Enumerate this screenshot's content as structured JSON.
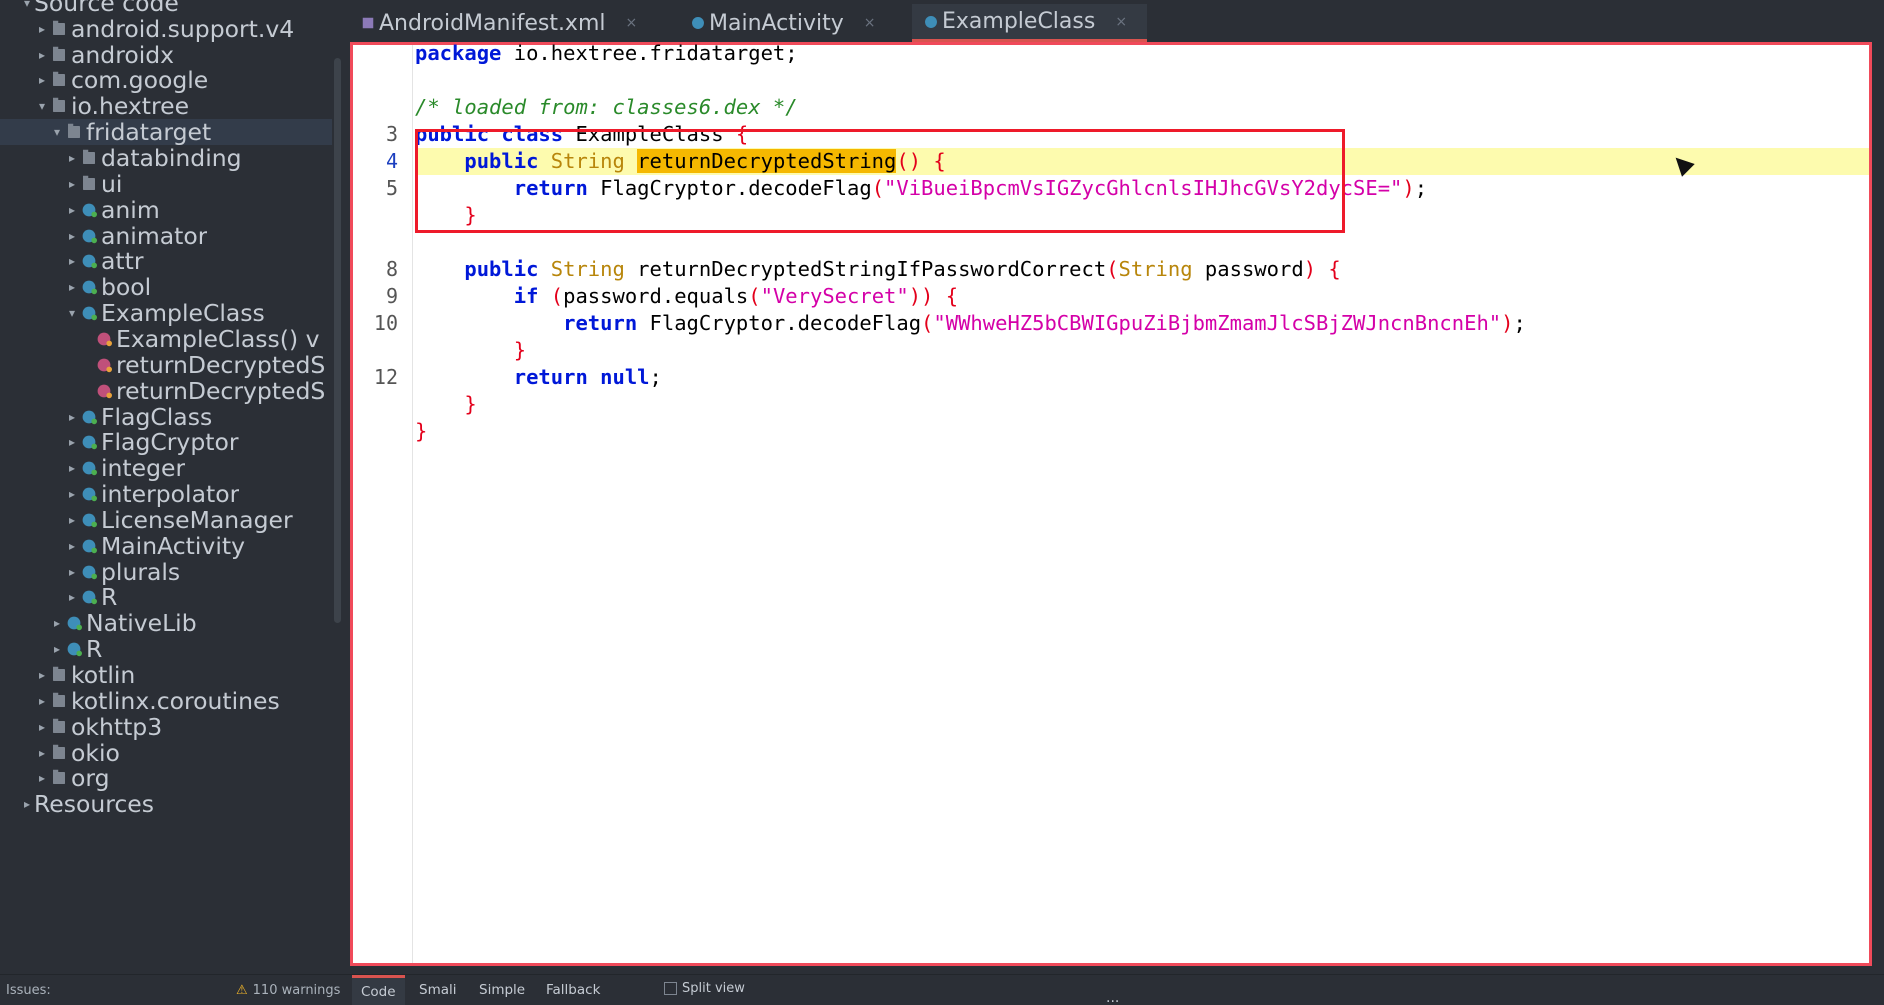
{
  "sidebar": {
    "items": [
      {
        "label": "Source code",
        "depth": 0,
        "arrow": "▾",
        "icon": "none"
      },
      {
        "label": "android.support.v4",
        "depth": 1,
        "arrow": "▸",
        "icon": "package"
      },
      {
        "label": "androidx",
        "depth": 1,
        "arrow": "▸",
        "icon": "package"
      },
      {
        "label": "com.google",
        "depth": 1,
        "arrow": "▸",
        "icon": "package"
      },
      {
        "label": "io.hextree",
        "depth": 1,
        "arrow": "▾",
        "icon": "package"
      },
      {
        "label": "fridatarget",
        "depth": 2,
        "arrow": "▾",
        "icon": "package",
        "selected": true
      },
      {
        "label": "databinding",
        "depth": 3,
        "arrow": "▸",
        "icon": "package"
      },
      {
        "label": "ui",
        "depth": 3,
        "arrow": "▸",
        "icon": "package"
      },
      {
        "label": "anim",
        "depth": 3,
        "arrow": "▸",
        "icon": "class"
      },
      {
        "label": "animator",
        "depth": 3,
        "arrow": "▸",
        "icon": "class"
      },
      {
        "label": "attr",
        "depth": 3,
        "arrow": "▸",
        "icon": "class"
      },
      {
        "label": "bool",
        "depth": 3,
        "arrow": "▸",
        "icon": "class"
      },
      {
        "label": "ExampleClass",
        "depth": 3,
        "arrow": "▾",
        "icon": "class"
      },
      {
        "label": "ExampleClass() v",
        "depth": 4,
        "arrow": "",
        "icon": "method"
      },
      {
        "label": "returnDecryptedS",
        "depth": 4,
        "arrow": "",
        "icon": "method"
      },
      {
        "label": "returnDecryptedS",
        "depth": 4,
        "arrow": "",
        "icon": "method"
      },
      {
        "label": "FlagClass",
        "depth": 3,
        "arrow": "▸",
        "icon": "class"
      },
      {
        "label": "FlagCryptor",
        "depth": 3,
        "arrow": "▸",
        "icon": "class"
      },
      {
        "label": "integer",
        "depth": 3,
        "arrow": "▸",
        "icon": "class"
      },
      {
        "label": "interpolator",
        "depth": 3,
        "arrow": "▸",
        "icon": "class"
      },
      {
        "label": "LicenseManager",
        "depth": 3,
        "arrow": "▸",
        "icon": "class"
      },
      {
        "label": "MainActivity",
        "depth": 3,
        "arrow": "▸",
        "icon": "class"
      },
      {
        "label": "plurals",
        "depth": 3,
        "arrow": "▸",
        "icon": "class"
      },
      {
        "label": "R",
        "depth": 3,
        "arrow": "▸",
        "icon": "class"
      },
      {
        "label": "NativeLib",
        "depth": 2,
        "arrow": "▸",
        "icon": "class"
      },
      {
        "label": "R",
        "depth": 2,
        "arrow": "▸",
        "icon": "class"
      },
      {
        "label": "kotlin",
        "depth": 1,
        "arrow": "▸",
        "icon": "package"
      },
      {
        "label": "kotlinx.coroutines",
        "depth": 1,
        "arrow": "▸",
        "icon": "package"
      },
      {
        "label": "okhttp3",
        "depth": 1,
        "arrow": "▸",
        "icon": "package"
      },
      {
        "label": "okio",
        "depth": 1,
        "arrow": "▸",
        "icon": "package"
      },
      {
        "label": "org",
        "depth": 1,
        "arrow": "▸",
        "icon": "package"
      },
      {
        "label": "Resources",
        "depth": 0,
        "arrow": "▸",
        "icon": "none"
      }
    ]
  },
  "tabs": [
    {
      "label": "AndroidManifest.xml",
      "icon": "xml-file-icon",
      "active": false
    },
    {
      "label": "MainActivity",
      "icon": "class-icon",
      "active": false
    },
    {
      "label": "ExampleClass",
      "icon": "class-icon",
      "active": true
    }
  ],
  "tab_close_glyph": "×",
  "editor": {
    "gutter": [
      "",
      "",
      "",
      "3",
      "4",
      "5",
      "",
      "",
      "8",
      "9",
      "10",
      "",
      "12",
      "",
      ""
    ],
    "current_line": "4",
    "lines": [
      [
        {
          "t": "package",
          "c": "kw"
        },
        {
          "t": " io.hextree.fridatarget;"
        }
      ],
      [],
      [
        {
          "t": "/* loaded from: classes6.dex */",
          "c": "cm"
        }
      ],
      [
        {
          "t": "public",
          "c": "kw"
        },
        {
          "t": " "
        },
        {
          "t": "class",
          "c": "kw"
        },
        {
          "t": " ExampleClass "
        },
        {
          "t": "{",
          "c": "br"
        }
      ],
      [
        {
          "t": "    "
        },
        {
          "t": "public",
          "c": "kw"
        },
        {
          "t": " "
        },
        {
          "t": "String",
          "c": "ty"
        },
        {
          "t": " "
        },
        {
          "t": "returnDecryptedString",
          "c": "sel"
        },
        {
          "t": "()",
          "c": "br"
        },
        {
          "t": " "
        },
        {
          "t": "{",
          "c": "br"
        }
      ],
      [
        {
          "t": "        "
        },
        {
          "t": "return",
          "c": "kw"
        },
        {
          "t": " FlagCryptor.decodeFlag"
        },
        {
          "t": "(",
          "c": "br"
        },
        {
          "t": "\"ViBueiBpcmVsIGZycGhlcnlsIHJhcGVsY2dycSE=\"",
          "c": "st"
        },
        {
          "t": ")",
          "c": "br"
        },
        {
          "t": ";"
        }
      ],
      [
        {
          "t": "    "
        },
        {
          "t": "}",
          "c": "br"
        }
      ],
      [],
      [
        {
          "t": "    "
        },
        {
          "t": "public",
          "c": "kw"
        },
        {
          "t": " "
        },
        {
          "t": "String",
          "c": "ty"
        },
        {
          "t": " returnDecryptedStringIfPasswordCorrect"
        },
        {
          "t": "(",
          "c": "br"
        },
        {
          "t": "String",
          "c": "ty"
        },
        {
          "t": " password"
        },
        {
          "t": ")",
          "c": "br"
        },
        {
          "t": " "
        },
        {
          "t": "{",
          "c": "br"
        }
      ],
      [
        {
          "t": "        "
        },
        {
          "t": "if",
          "c": "kw"
        },
        {
          "t": " "
        },
        {
          "t": "(",
          "c": "br"
        },
        {
          "t": "password.equals"
        },
        {
          "t": "(",
          "c": "br"
        },
        {
          "t": "\"VerySecret\"",
          "c": "st"
        },
        {
          "t": "))",
          "c": "br"
        },
        {
          "t": " "
        },
        {
          "t": "{",
          "c": "br"
        }
      ],
      [
        {
          "t": "            "
        },
        {
          "t": "return",
          "c": "kw"
        },
        {
          "t": " FlagCryptor.decodeFlag"
        },
        {
          "t": "(",
          "c": "br"
        },
        {
          "t": "\"WWhweHZ5bCBWIGpuZiBjbmZmamJlcSBjZWJncnBncnEh\"",
          "c": "st"
        },
        {
          "t": ")",
          "c": "br"
        },
        {
          "t": ";"
        }
      ],
      [
        {
          "t": "        "
        },
        {
          "t": "}",
          "c": "br"
        }
      ],
      [
        {
          "t": "        "
        },
        {
          "t": "return",
          "c": "kw"
        },
        {
          "t": " "
        },
        {
          "t": "null",
          "c": "kw"
        },
        {
          "t": ";"
        }
      ],
      [
        {
          "t": "    "
        },
        {
          "t": "}",
          "c": "br"
        }
      ],
      [
        {
          "t": "}",
          "c": "br"
        }
      ]
    ]
  },
  "statusbar": {
    "issues_label": "Issues:",
    "warnings": "110 warnings",
    "bottom_tabs": [
      {
        "label": "Code",
        "active": true
      },
      {
        "label": "Smali",
        "active": false
      },
      {
        "label": "Simple",
        "active": false
      },
      {
        "label": "Fallback",
        "active": false
      }
    ],
    "split_view_label": "Split view",
    "more": "..."
  },
  "colors": {
    "background": "#2b2f36",
    "editor_border": "#f04a5a",
    "highlight_box": "#ee1a2a",
    "keyword": "#0018d8",
    "string": "#d400a8",
    "type": "#b8860b",
    "comment": "#2a8a2a",
    "line_highlight": "#fdfbae",
    "selection": "#f5b800"
  }
}
